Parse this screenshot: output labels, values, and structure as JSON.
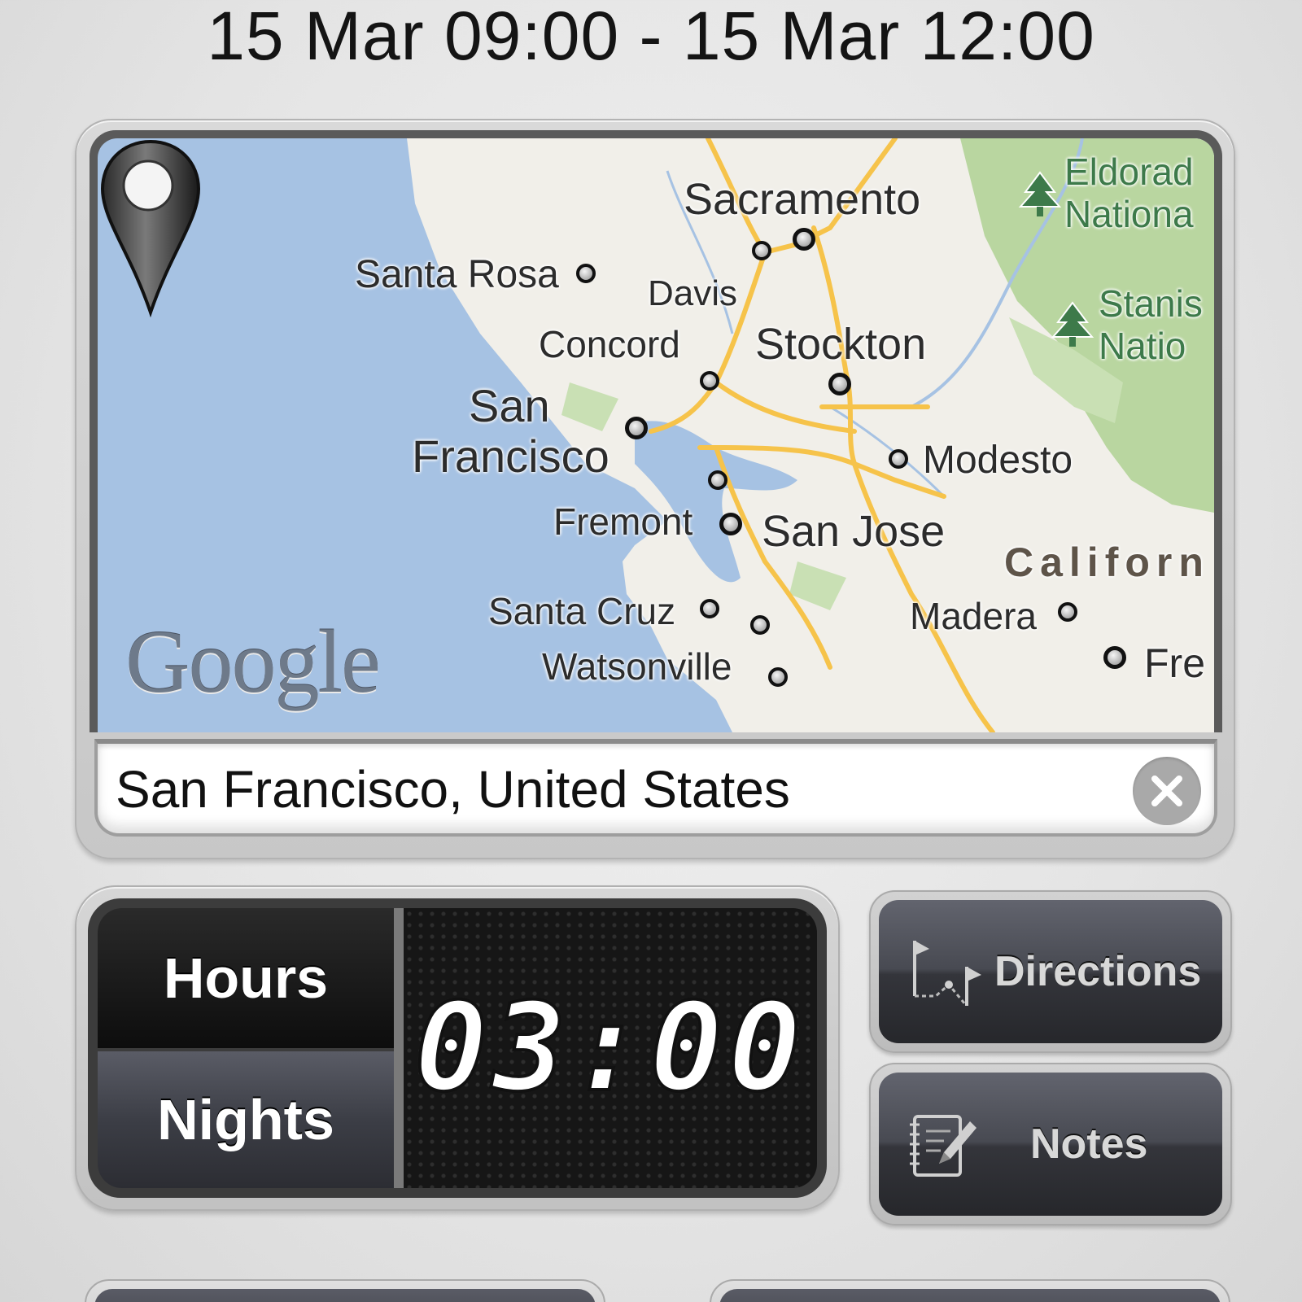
{
  "header": {
    "date_range": "15 Mar 09:00 - 15 Mar 12:00"
  },
  "map": {
    "provider_logo": "Google",
    "cities": [
      {
        "name": "Sacramento"
      },
      {
        "name": "Santa Rosa"
      },
      {
        "name": "Davis"
      },
      {
        "name": "Concord"
      },
      {
        "name": "Stockton"
      },
      {
        "name": "San"
      },
      {
        "name": "Francisco"
      },
      {
        "name": "Modesto"
      },
      {
        "name": "Fremont"
      },
      {
        "name": "San Jose"
      },
      {
        "name": "Santa Cruz"
      },
      {
        "name": "Watsonville"
      },
      {
        "name": "Madera"
      },
      {
        "name": "Fre"
      }
    ],
    "regions": {
      "eldorado_1": "Eldorad",
      "eldorado_2": "Nationa",
      "stanislaus_1": "Stanis",
      "stanislaus_2": "Natio",
      "state": "Californ"
    },
    "icons": {
      "marker": "map-pin-icon",
      "forest": "tree-icon"
    },
    "colors": {
      "water": "#a6c2e3",
      "land": "#f1efe9",
      "forest": "#b9d6a0",
      "road": "#f6c34a"
    }
  },
  "search": {
    "value": "San Francisco, United States",
    "clear_icon": "close-icon"
  },
  "timer": {
    "mode_hours_label": "Hours",
    "mode_nights_label": "Nights",
    "value": "03:00",
    "selected_mode": "Hours"
  },
  "actions": {
    "directions_label": "Directions",
    "directions_icon": "route-flags-icon",
    "notes_label": "Notes",
    "notes_icon": "notepad-pencil-icon"
  }
}
